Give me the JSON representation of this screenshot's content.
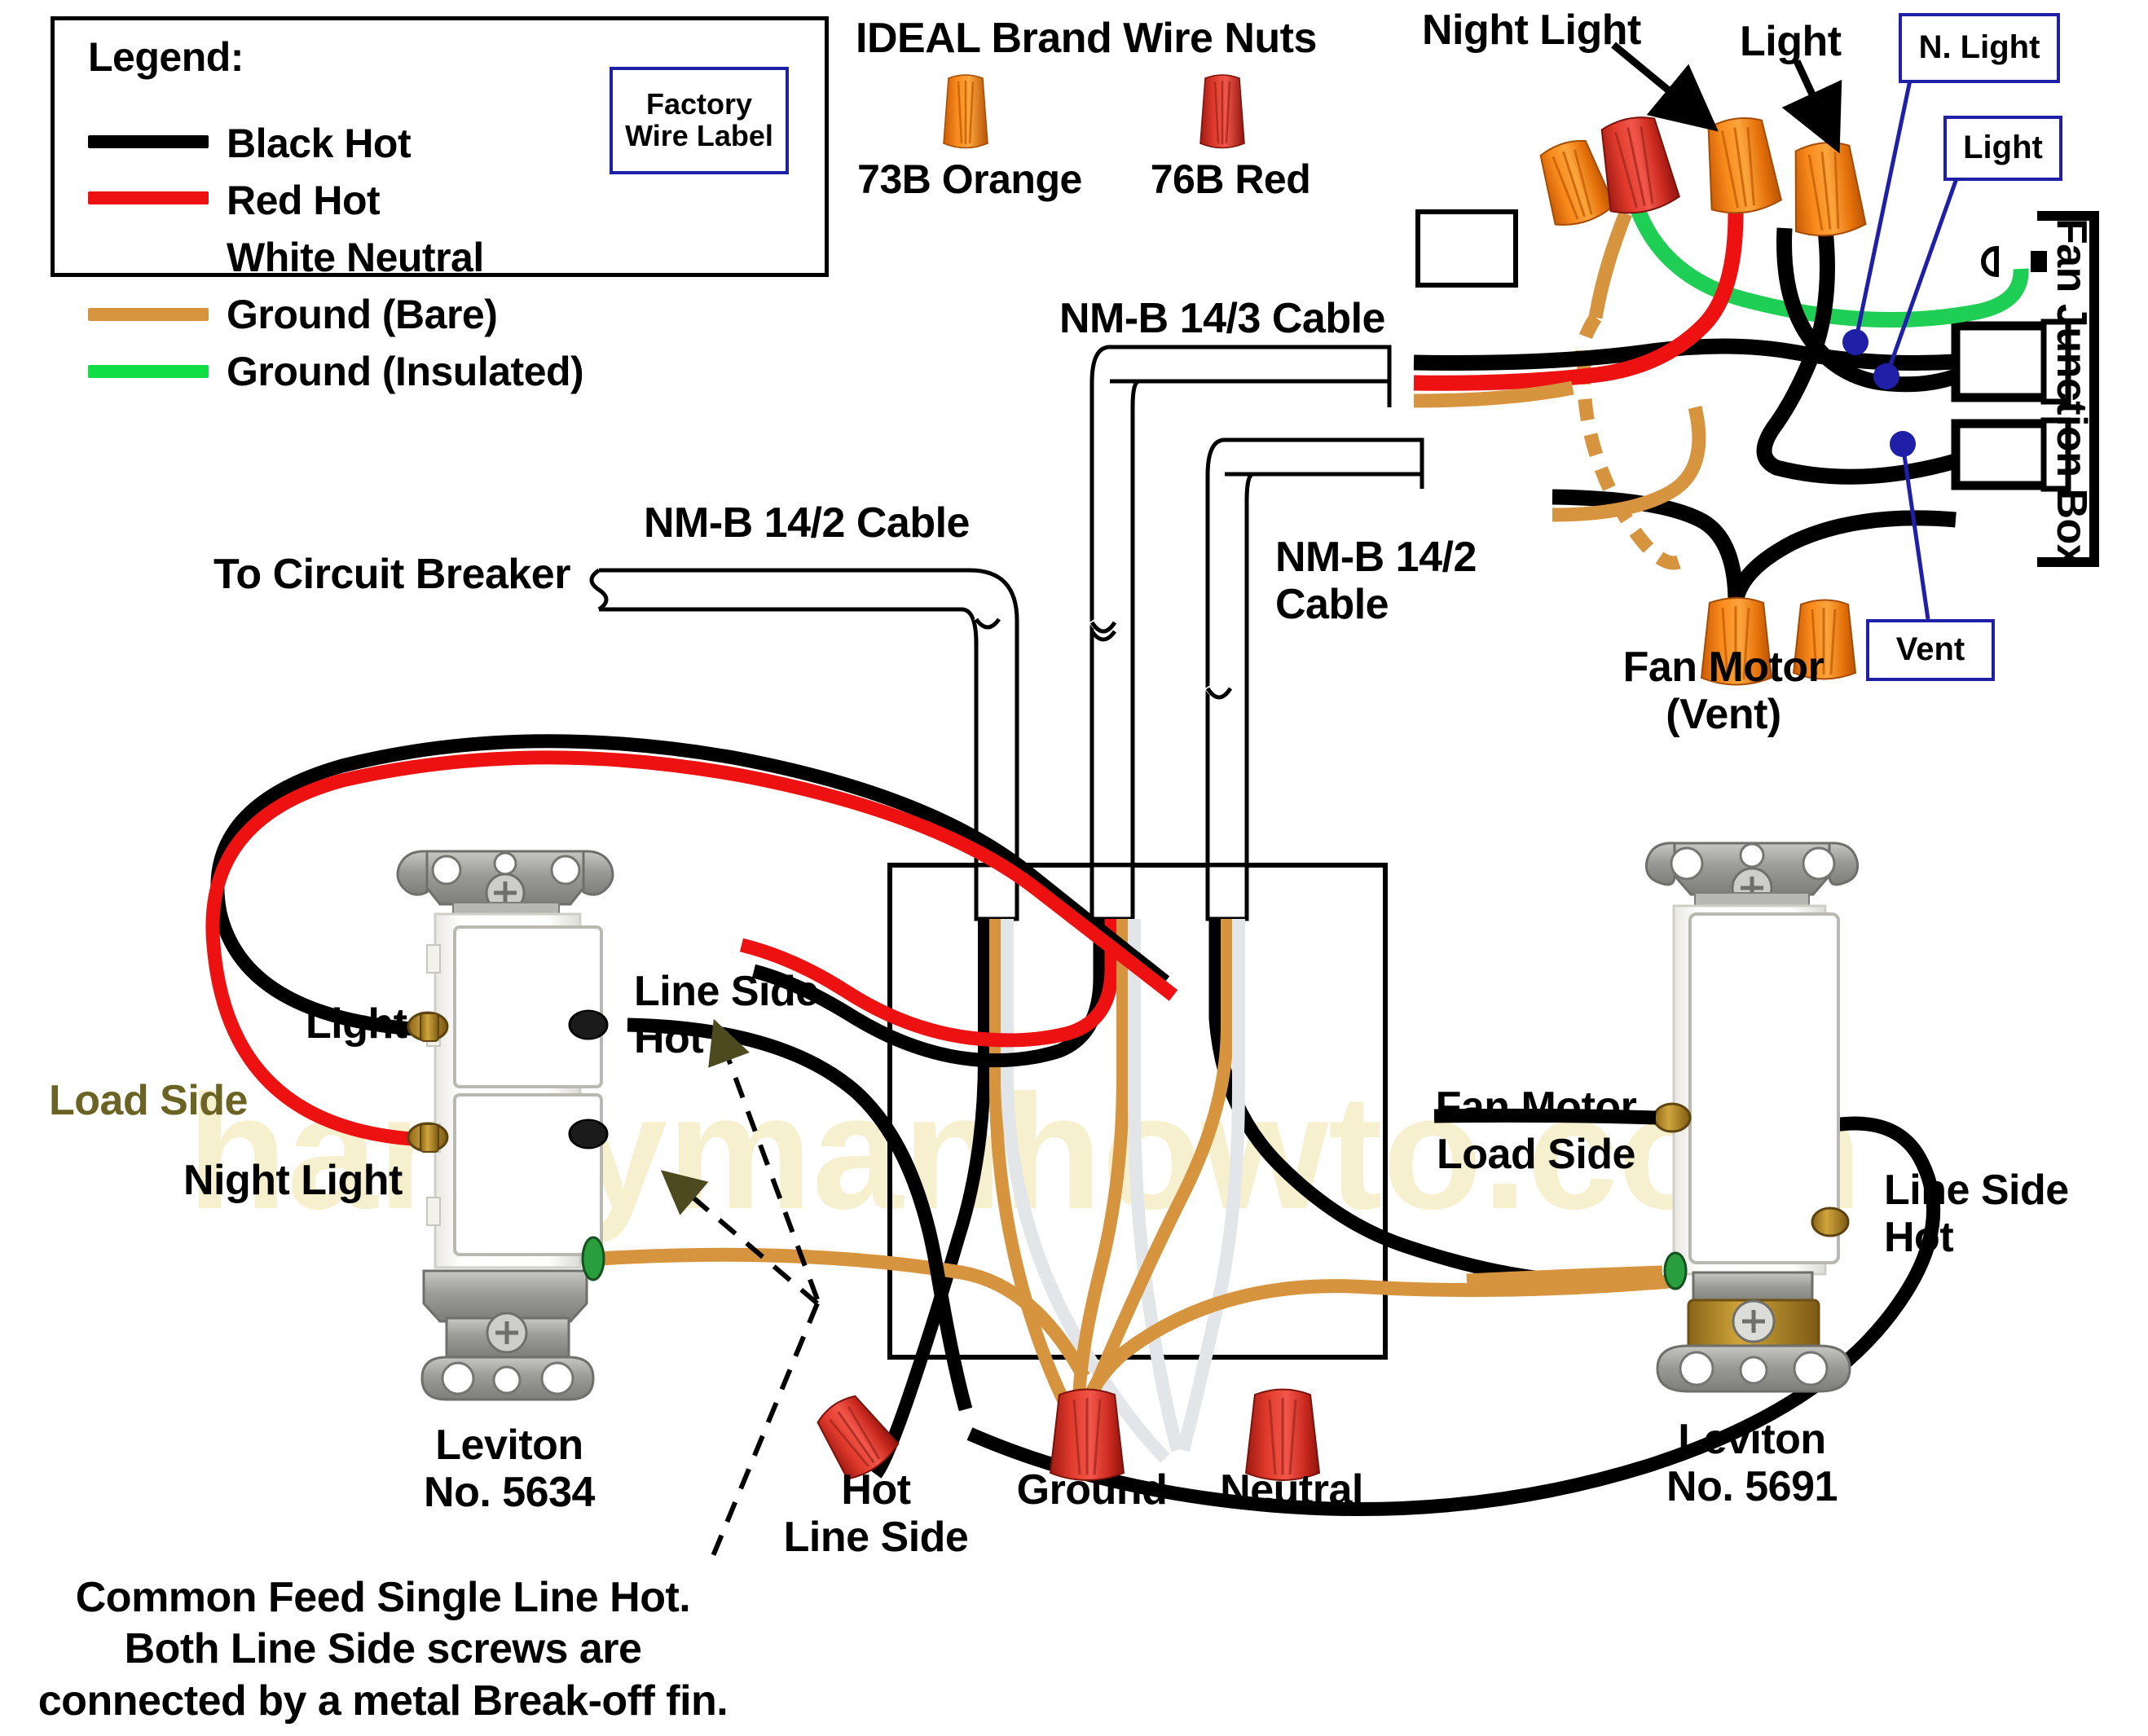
{
  "legend": {
    "title": "Legend:",
    "items": [
      {
        "label": "Black Hot",
        "color": "#000000",
        "swatch": true
      },
      {
        "label": "Red Hot",
        "color": "#ee1111",
        "swatch": true
      },
      {
        "label": "White Neutral",
        "color": "#ffffff",
        "swatch": false
      },
      {
        "label": "Ground (Bare)",
        "color": "#d6943f",
        "swatch": true
      },
      {
        "label": "Ground (Insulated)",
        "color": "#11dd44",
        "swatch": true
      }
    ],
    "factory_wire_label": "Factory\nWire Label"
  },
  "wire_nuts_panel": {
    "title": "IDEAL Brand Wire Nuts",
    "nuts": [
      {
        "label": "73B Orange",
        "color": "#f07a12"
      },
      {
        "label": "76B Red",
        "color": "#d42b20"
      }
    ]
  },
  "callouts": {
    "night_light": "Night Light",
    "light": "Light",
    "nmb_14_3": "NM-B 14/3 Cable",
    "nmb_14_2_right": "NM-B 14/2\nCable",
    "nmb_14_2_top": "NM-B 14/2 Cable",
    "to_circuit_breaker": "To Circuit Breaker",
    "fan_motor_vent": "Fan Motor\n(Vent)",
    "fan_junction_box": "Fan Junction Box"
  },
  "blue_labels": {
    "n_light": "N. Light",
    "light": "Light",
    "vent": "Vent"
  },
  "left_switch": {
    "name": "Leviton\nNo. 5634",
    "terminal_light": "Light",
    "terminal_night_light": "Night Light",
    "load_side": "Load Side",
    "line_side_hot": "Line Side\nHot"
  },
  "right_switch": {
    "name": "Leviton\nNo. 5691",
    "fan_motor_load_side": "Fan Motor\nLoad Side",
    "line_side_hot": "Line Side\nHot"
  },
  "junction_nuts": {
    "hot_line_side": "Hot\nLine Side",
    "ground": "Ground",
    "neutral": "Neutral"
  },
  "footnote": "Common Feed Single Line Hot.\nBoth Line Side screws are\nconnected by a metal Break-off fin.",
  "watermark": "handymanhowto.com",
  "colors": {
    "black": "#000000",
    "red": "#ee1111",
    "white_wire": "#e3e6e8",
    "ground_bare": "#d6943f",
    "ground_insulated": "#1fcf55",
    "blue": "#1f1fa8",
    "nut_orange": "#f07a12",
    "nut_red": "#d9342a",
    "metal": "#9a9a99",
    "brass": "#b08830",
    "green_screw": "#2a9d3f"
  }
}
